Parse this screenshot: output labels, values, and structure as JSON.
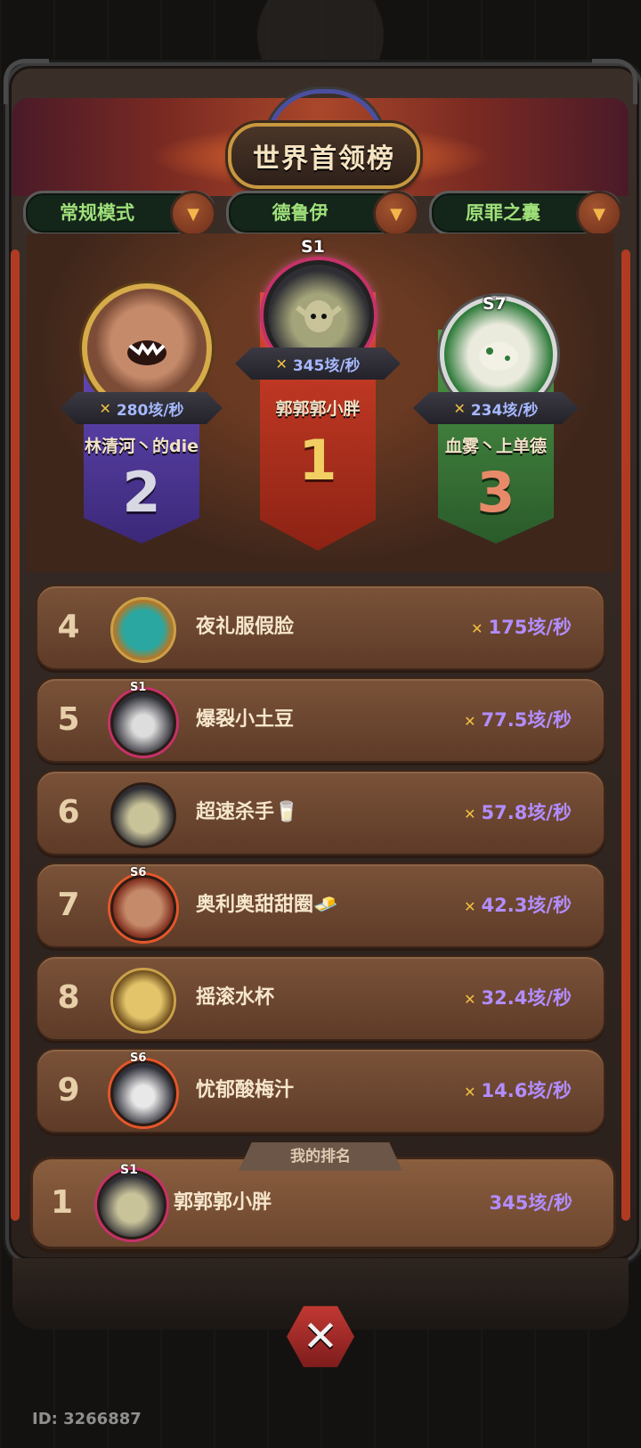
{
  "title": "世界首领榜",
  "tabs": [
    {
      "label": "常规模式"
    },
    {
      "label": "德鲁伊"
    },
    {
      "label": "原罪之囊"
    }
  ],
  "podium": [
    {
      "rank_label": "2",
      "name": "林清河丶的die",
      "score": "280垓/秒",
      "season": "",
      "color": "#5b3fa8"
    },
    {
      "rank_label": "1",
      "name": "郭郭郭小胖",
      "score": "345垓/秒",
      "season": "S1",
      "color": "#b8321f"
    },
    {
      "rank_label": "3",
      "name": "血雾丶上单德",
      "score": "234垓/秒",
      "season": "S7",
      "color": "#3f7a3e"
    }
  ],
  "rows": [
    {
      "rank": "4",
      "name": "夜礼服假脸",
      "score": "175垓/秒",
      "season": ""
    },
    {
      "rank": "5",
      "name": "爆裂小土豆",
      "score": "77.5垓/秒",
      "season": "S1"
    },
    {
      "rank": "6",
      "name": "超速杀手🥛",
      "score": "57.8垓/秒",
      "season": ""
    },
    {
      "rank": "7",
      "name": "奥利奥甜甜圈🧈",
      "score": "42.3垓/秒",
      "season": "S6"
    },
    {
      "rank": "8",
      "name": "摇滚水杯",
      "score": "32.4垓/秒",
      "season": ""
    },
    {
      "rank": "9",
      "name": "忧郁酸梅汁",
      "score": "14.6垓/秒",
      "season": "S6"
    }
  ],
  "my_rank": {
    "label": "我的排名",
    "rank": "1",
    "name": "郭郭郭小胖",
    "score": "345垓/秒",
    "season": "S1"
  },
  "footer": {
    "id": "ID: 3266887"
  },
  "icons": {
    "dropdown": "chevron-down-icon",
    "sword": "crossed-swords-icon",
    "close": "close-icon"
  }
}
